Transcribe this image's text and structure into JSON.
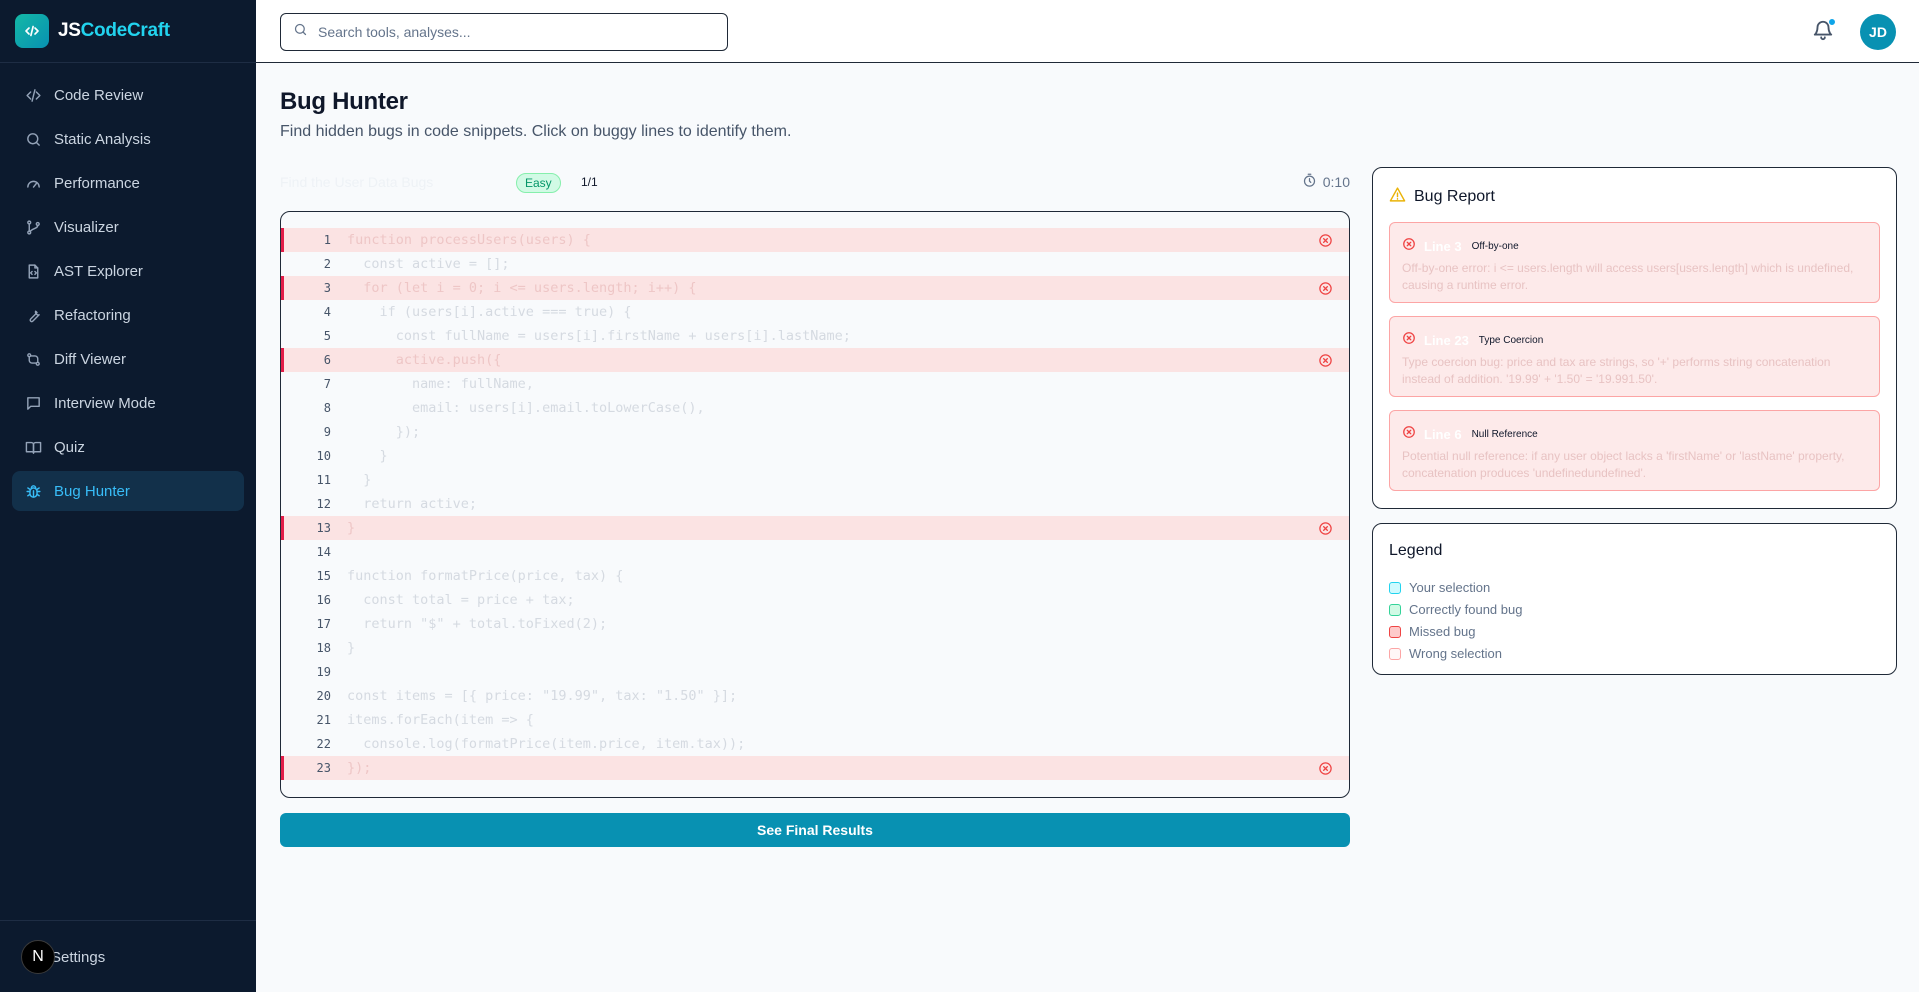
{
  "app": {
    "brand_prefix": "JS",
    "brand_suffix": "CodeCraft"
  },
  "sidebar": {
    "items": [
      {
        "label": "Code Review",
        "icon": "code-icon"
      },
      {
        "label": "Static Analysis",
        "icon": "search-icon"
      },
      {
        "label": "Performance",
        "icon": "gauge-icon"
      },
      {
        "label": "Visualizer",
        "icon": "git-branch-icon"
      },
      {
        "label": "AST Explorer",
        "icon": "file-code-icon"
      },
      {
        "label": "Refactoring",
        "icon": "wrench-icon"
      },
      {
        "label": "Diff Viewer",
        "icon": "git-compare-icon"
      },
      {
        "label": "Interview Mode",
        "icon": "message-square-icon"
      },
      {
        "label": "Quiz",
        "icon": "book-open-icon"
      },
      {
        "label": "Bug Hunter",
        "icon": "bug-icon",
        "active": true
      }
    ],
    "footer": {
      "badge": "N",
      "label": "Settings"
    }
  },
  "topbar": {
    "search_placeholder": "Search tools, analyses...",
    "avatar_initials": "JD"
  },
  "page": {
    "title": "Bug Hunter",
    "subtitle": "Find hidden bugs in code snippets. Click on buggy lines to identify them."
  },
  "challenge": {
    "title": "Find the User Data Bugs",
    "difficulty": "Easy",
    "counter": "1/1",
    "timer": "0:10"
  },
  "code": {
    "lines": [
      {
        "n": "1",
        "text": "function processUsers(users) {",
        "bug": true
      },
      {
        "n": "2",
        "text": "  const active = [];",
        "bug": false
      },
      {
        "n": "3",
        "text": "  for (let i = 0; i <= users.length; i++) {",
        "bug": true
      },
      {
        "n": "4",
        "text": "    if (users[i].active === true) {",
        "bug": false
      },
      {
        "n": "5",
        "text": "      const fullName = users[i].firstName + users[i].lastName;",
        "bug": false
      },
      {
        "n": "6",
        "text": "      active.push({",
        "bug": true
      },
      {
        "n": "7",
        "text": "        name: fullName,",
        "bug": false
      },
      {
        "n": "8",
        "text": "        email: users[i].email.toLowerCase(),",
        "bug": false
      },
      {
        "n": "9",
        "text": "      });",
        "bug": false
      },
      {
        "n": "10",
        "text": "    }",
        "bug": false
      },
      {
        "n": "11",
        "text": "  }",
        "bug": false
      },
      {
        "n": "12",
        "text": "  return active;",
        "bug": false
      },
      {
        "n": "13",
        "text": "}",
        "bug": true
      },
      {
        "n": "14",
        "text": "",
        "bug": false
      },
      {
        "n": "15",
        "text": "function formatPrice(price, tax) {",
        "bug": false
      },
      {
        "n": "16",
        "text": "  const total = price + tax;",
        "bug": false
      },
      {
        "n": "17",
        "text": "  return \"$\" + total.toFixed(2);",
        "bug": false
      },
      {
        "n": "18",
        "text": "}",
        "bug": false
      },
      {
        "n": "19",
        "text": "",
        "bug": false
      },
      {
        "n": "20",
        "text": "const items = [{ price: \"19.99\", tax: \"1.50\" }];",
        "bug": false
      },
      {
        "n": "21",
        "text": "items.forEach(item => {",
        "bug": false
      },
      {
        "n": "22",
        "text": "  console.log(formatPrice(item.price, item.tax));",
        "bug": false
      },
      {
        "n": "23",
        "text": "});",
        "bug": true
      }
    ]
  },
  "actions": {
    "results_label": "See Final Results"
  },
  "report": {
    "title": "Bug Report",
    "bugs": [
      {
        "line": "Line 3",
        "type": "Off-by-one",
        "description": "Off-by-one error: i <= users.length will access users[users.length] which is undefined, causing a runtime error."
      },
      {
        "line": "Line 23",
        "type": "Type Coercion",
        "description": "Type coercion bug: price and tax are strings, so '+' performs string concatenation instead of addition. '19.99' + '1.50' = '19.991.50'."
      },
      {
        "line": "Line 6",
        "type": "Null Reference",
        "description": "Potential null reference: if any user object lacks a 'firstName' or 'lastName' property, concatenation produces 'undefinedundefined'."
      }
    ]
  },
  "legend": {
    "title": "Legend",
    "items": [
      {
        "label": "Your selection",
        "fill": "#cffafe",
        "border": "#22d3ee"
      },
      {
        "label": "Correctly found bug",
        "fill": "#d1fae5",
        "border": "#34d399"
      },
      {
        "label": "Missed bug",
        "fill": "#fecaca",
        "border": "#ef4444"
      },
      {
        "label": "Wrong selection",
        "fill": "#fff7f7",
        "border": "#fca5a5"
      }
    ]
  },
  "colors": {
    "accent": "#0891b2",
    "sidebar_bg": "#0c1a2e",
    "bug_row": "#fbe3e3",
    "bug_marker": "#e11d48"
  }
}
